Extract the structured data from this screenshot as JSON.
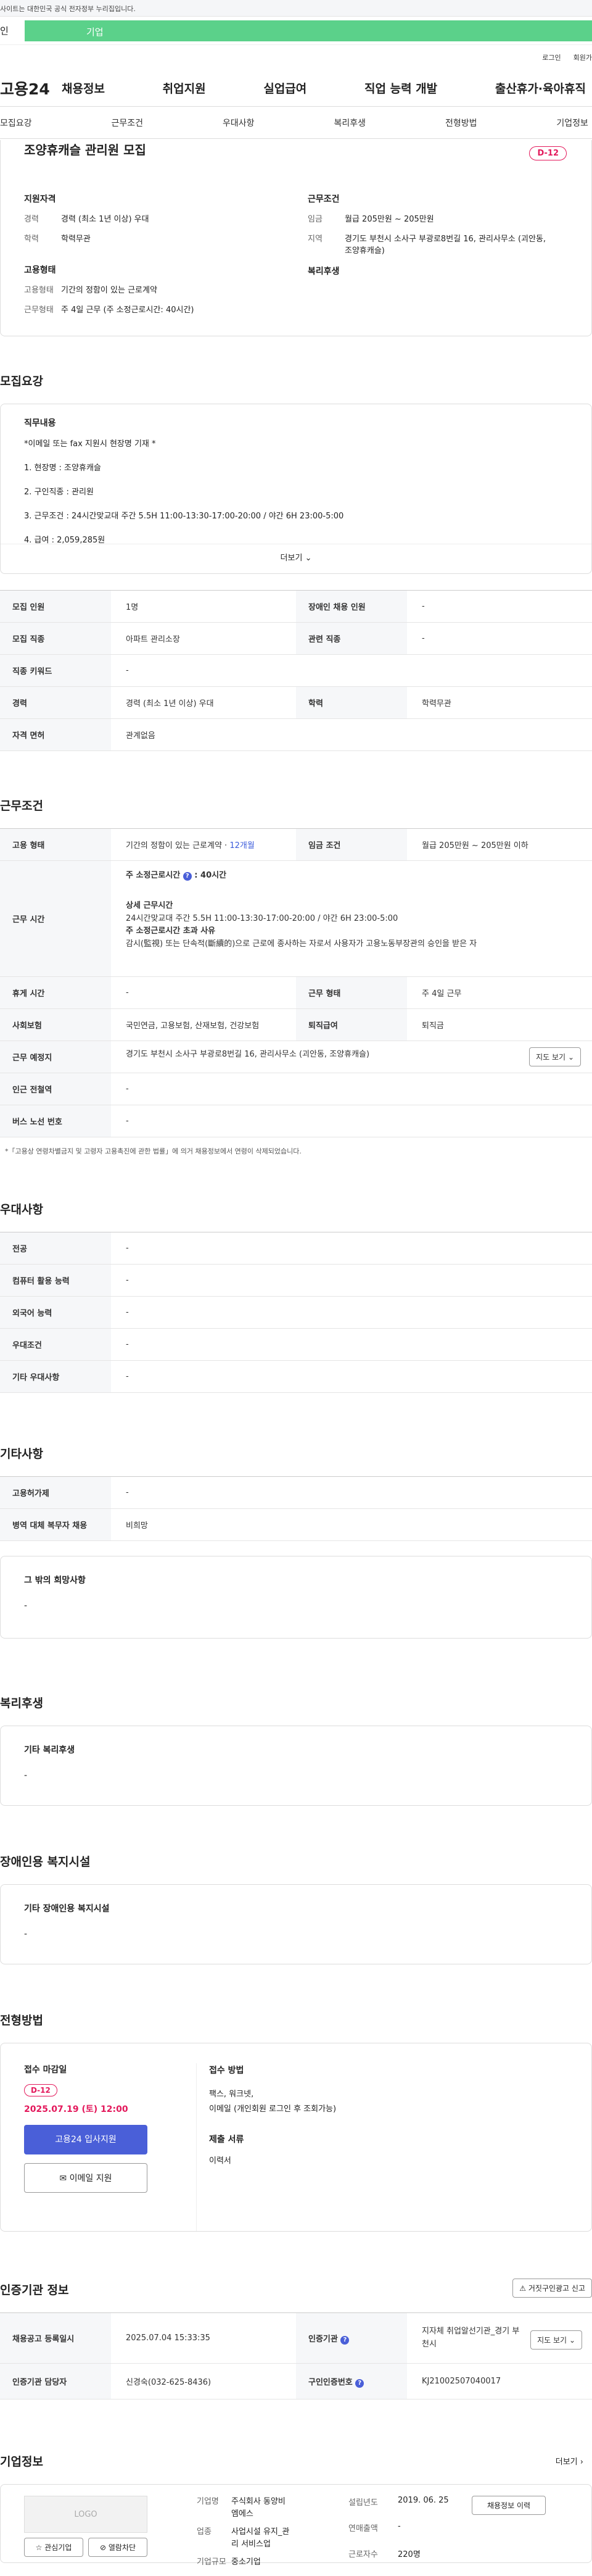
{
  "notice": "사이트는 대한민국 공식 전자정부 누리집입니다.",
  "typebar": {
    "left": "인",
    "active": "기업"
  },
  "util": {
    "login": "로그인",
    "join": "회원가"
  },
  "gnb": {
    "logo": "고용24",
    "menu": [
      "채용정보",
      "취업지원",
      "실업급여",
      "직업 능력 개발",
      "출산휴가·육아휴직"
    ]
  },
  "tabs": [
    "모집요강",
    "근무조건",
    "우대사항",
    "복리후생",
    "전형방법",
    "기업정보"
  ],
  "summary": {
    "title": "조양휴캐슬 관리원 모집",
    "dday": "D-12",
    "qual_h": "지원자격",
    "career_k": "경력",
    "career_v": "경력 (최소 1년 이상) 우대",
    "edu_k": "학력",
    "edu_v": "학력무관",
    "work_h": "근무조건",
    "wage_k": "임금",
    "wage_v": "월급 205만원 ~ 205만원",
    "area_k": "지역",
    "area_v": "경기도 부천시 소사구 부광로8번길 16, 관리사무소 (괴안동, 조양휴캐슬)",
    "emp_h": "고용형태",
    "emptype_k": "고용형태",
    "emptype_v": "기간의 정함이 있는 근로계약",
    "worktype_k": "근무형태",
    "worktype_v": "주 4일 근무 (주 소정근로시간: 40시간)",
    "welfare_h": "복리후생"
  },
  "recruit": {
    "title": "모집요강",
    "duty_h": "직무내용",
    "lines": [
      "*이메일 또는 fax 지원시 현장명 기재 *",
      "1. 현장명 : 조양휴캐슬",
      "2. 구인직종 : 관리원",
      "3. 근무조건 : 24시간맞교대 주간 5.5H 11:00-13:30-17:00-20:00 / 야간 6H 23:00-5:00",
      "4. 급여 : 2,059,285원"
    ],
    "more": "더보기",
    "rows": [
      {
        "k1": "모집 인원",
        "v1": "1명",
        "k2": "장애인 채용 인원",
        "v2": "-"
      },
      {
        "k1": "모집 직종",
        "v1": "아파트 관리소장",
        "k2": "관련 직종",
        "v2": "-"
      },
      {
        "k1": "직종 키워드",
        "v1": "-"
      },
      {
        "k1": "경력",
        "v1": "경력 (최소 1년 이상) 우대",
        "k2": "학력",
        "v2": "학력무관"
      },
      {
        "k1": "자격 면허",
        "v1": "관계없음"
      }
    ]
  },
  "cond": {
    "title": "근무조건",
    "emp_k": "고용 형태",
    "emp_v": "기간의 정함이 있는 근로계약 ·",
    "emp_link": "12개월",
    "wage_k": "임금 조건",
    "wage_v": "월급 205만원 ~ 205만원 이하",
    "time_k": "근무 시간",
    "hours_label": "주 소정근로시간",
    "hours_val": "40시간",
    "detail_h": "상세 근무시간",
    "detail_v": "24시간맞교대 주간 5.5H 11:00-13:30-17:00-20:00 / 야간 6H 23:00-5:00",
    "over_h": "주 소정근로시간 초과 사유",
    "over_v": "감시(監視) 또는 단속적(斷續的)으로 근로에 종사하는 자로서 사용자가 고용노동부장관의 승인을 받은 자",
    "rest_k": "휴게 시간",
    "rest_v": "-",
    "form_k": "근무 형태",
    "form_v": "주 4일 근무",
    "ins_k": "사회보험",
    "ins_v": "국민연금, 고용보험, 산재보험, 건강보험",
    "ret_k": "퇴직급여",
    "ret_v": "퇴직금",
    "place_k": "근무 예정지",
    "place_v": "경기도 부천시 소사구 부광로8번길 16, 관리사무소 (괴안동, 조양휴캐슬)",
    "map_btn": "지도 보기",
    "subway_k": "인근 전철역",
    "subway_v": "-",
    "bus_k": "버스 노선 번호",
    "bus_v": "-",
    "note": "*「고용상 연령차별금지 및 고령자 고용촉진에 관한 법률」에 의거 채용정보에서 연령이 삭제되었습니다."
  },
  "pref": {
    "title": "우대사항",
    "rows": [
      [
        "전공",
        "-"
      ],
      [
        "컴퓨터 활용 능력",
        "-"
      ],
      [
        "외국어 능력",
        "-"
      ],
      [
        "우대조건",
        "-"
      ],
      [
        "기타 우대사항",
        "-"
      ]
    ]
  },
  "etc": {
    "title": "기타사항",
    "rows": [
      [
        "고용허가제",
        "-"
      ],
      [
        "병역 대체 복무자 채용",
        "비희망"
      ]
    ],
    "hope_h": "그 밖의 희망사항",
    "hope_v": "-"
  },
  "welfare": {
    "title": "복리후생",
    "h": "기타 복리후생",
    "v": "-"
  },
  "disabled": {
    "title": "장애인용 복지시설",
    "h": "기타 장애인용 복지시설",
    "v": "-"
  },
  "process": {
    "title": "전형방법",
    "deadline_h": "접수 마감일",
    "dday": "D-12",
    "deadline": "2025.07.19 (토) 12:00",
    "apply_btn": "고용24 입사지원",
    "email_btn": "이메일 지원",
    "method_h": "접수 방법",
    "method_v1": "팩스, 워크넷,",
    "method_v2": "이메일 (개인회원 로그인 후 조회가능)",
    "docs_h": "제출 서류",
    "docs_v": "이력서"
  },
  "cert": {
    "title": "인증기관 정보",
    "report_btn": "거짓구인광고 신고",
    "reg_k": "채용공고 등록일시",
    "reg_v": "2025.07.04 15:33:35",
    "org_k": "인증기관",
    "org_v": "지자체 취업알선기관_경기 부천시",
    "map_btn": "지도 보기",
    "mgr_k": "인증기관 담당자",
    "mgr_v": "신경숙(032-625-8436)",
    "num_k": "구인인증번호",
    "num_v": "KJ21002507040017"
  },
  "company": {
    "title": "기업정보",
    "more": "더보기",
    "logo": "LOGO",
    "fav": "관심기업",
    "blocked": "열람차단",
    "name_k": "기업명",
    "name_v1": "주식회사 동양비",
    "name_v2": "엠에스",
    "ind_k": "업종",
    "ind_v1": "사업시설 유지_관",
    "ind_v2": "리 서비스업",
    "size_k": "기업규모",
    "size_v": "중소기업",
    "est_k": "설립년도",
    "est_v": "2019. 06. 25",
    "sales_k": "연매출액",
    "sales_v": "-",
    "emp_k": "근로자수",
    "emp_v": "220명",
    "jobs_btn": "채용정보 이력"
  }
}
